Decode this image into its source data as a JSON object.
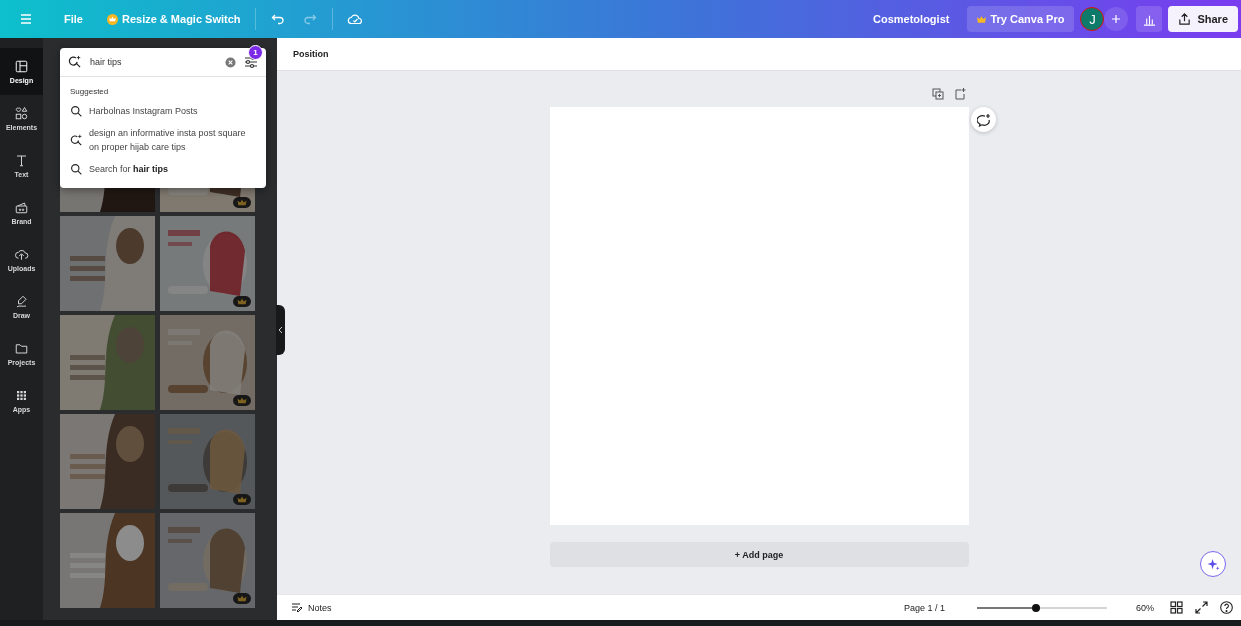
{
  "topbar": {
    "file": "File",
    "resize": "Resize & Magic Switch",
    "design_name": "Cosmetologist",
    "try_pro": "Try Canva Pro",
    "avatar": "J",
    "share": "Share"
  },
  "rail": [
    {
      "label": "Design",
      "selected": true
    },
    {
      "label": "Elements",
      "selected": false
    },
    {
      "label": "Text",
      "selected": false
    },
    {
      "label": "Brand",
      "selected": false
    },
    {
      "label": "Uploads",
      "selected": false
    },
    {
      "label": "Draw",
      "selected": false
    },
    {
      "label": "Projects",
      "selected": false
    },
    {
      "label": "Apps",
      "selected": false
    }
  ],
  "search": {
    "value": "hair tips",
    "filter_badge": "1",
    "suggested_heading": "Suggested",
    "suggestions": [
      {
        "kind": "search",
        "text": "Harbolnas Instagram Posts"
      },
      {
        "kind": "magic",
        "text": "design an informative insta post square on proper hijab care tips"
      },
      {
        "kind": "search",
        "text": "Search for **hair tips**"
      }
    ]
  },
  "templates": [
    {
      "kind": "picture",
      "premium": false
    },
    {
      "kind": "picture",
      "premium": true
    },
    {
      "kind": "picture",
      "premium": false
    },
    {
      "kind": "picture",
      "premium": true
    },
    {
      "kind": "picture",
      "premium": false
    },
    {
      "kind": "picture",
      "premium": true
    },
    {
      "kind": "picture",
      "premium": false
    },
    {
      "kind": "picture",
      "premium": true
    },
    {
      "kind": "picture",
      "premium": false
    },
    {
      "kind": "picture",
      "premium": true
    }
  ],
  "toolbar": {
    "position": "Position"
  },
  "canvas": {
    "add_page": "+ Add page"
  },
  "footer": {
    "notes": "Notes",
    "page": "Page 1 / 1",
    "zoom": {
      "level": 0.45
    },
    "zoom_reading": "60%"
  }
}
